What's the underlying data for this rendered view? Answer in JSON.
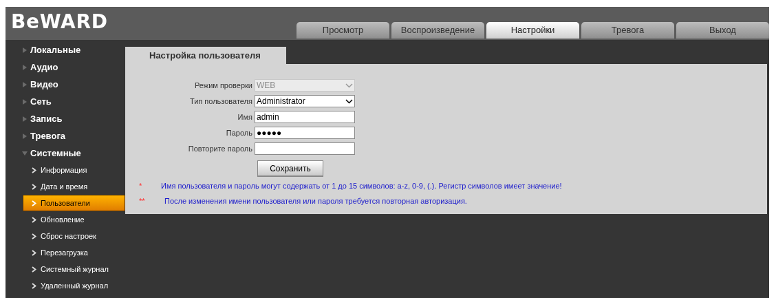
{
  "logo": "BeWARD",
  "tabs": [
    {
      "label": "Просмотр",
      "selected": false
    },
    {
      "label": "Воспроизведение",
      "selected": false
    },
    {
      "label": "Настройки",
      "selected": true
    },
    {
      "label": "Тревога",
      "selected": false
    },
    {
      "label": "Выход",
      "selected": false
    }
  ],
  "sidebar": {
    "items": [
      {
        "label": "Локальные",
        "expanded": false
      },
      {
        "label": "Аудио",
        "expanded": false
      },
      {
        "label": "Видео",
        "expanded": false
      },
      {
        "label": "Сеть",
        "expanded": false
      },
      {
        "label": "Запись",
        "expanded": false
      },
      {
        "label": "Тревога",
        "expanded": false
      },
      {
        "label": "Системные",
        "expanded": true,
        "children": [
          {
            "label": "Информация",
            "selected": false
          },
          {
            "label": "Дата и время",
            "selected": false
          },
          {
            "label": "Пользователи",
            "selected": true
          },
          {
            "label": "Обновление",
            "selected": false
          },
          {
            "label": "Сброс настроек",
            "selected": false
          },
          {
            "label": "Перезагрузка",
            "selected": false
          },
          {
            "label": "Системный журнал",
            "selected": false
          },
          {
            "label": "Удаленный журнал",
            "selected": false
          }
        ]
      }
    ]
  },
  "panel": {
    "title": "Настройка пользователя",
    "fields": [
      {
        "kind": "select",
        "label": "Режим проверки",
        "value": "WEB",
        "disabled": true
      },
      {
        "kind": "select",
        "label": "Тип пользователя",
        "value": "Administrator",
        "disabled": false
      },
      {
        "kind": "text",
        "label": "Имя",
        "value": "admin"
      },
      {
        "kind": "text",
        "label": "Пароль",
        "value": "●●●●●"
      },
      {
        "kind": "text",
        "label": "Повторите пароль"
      }
    ],
    "save_button": "Сохранить",
    "notes": [
      {
        "marker": "*",
        "text": "Имя пользователя и пароль могут содержать от 1 до 15 символов: a-z, 0-9, (.). Регистр символов имеет значение!"
      },
      {
        "marker": "**",
        "text": "После изменения имени пользователя или пароля требуется повторная авторизация."
      }
    ]
  }
}
